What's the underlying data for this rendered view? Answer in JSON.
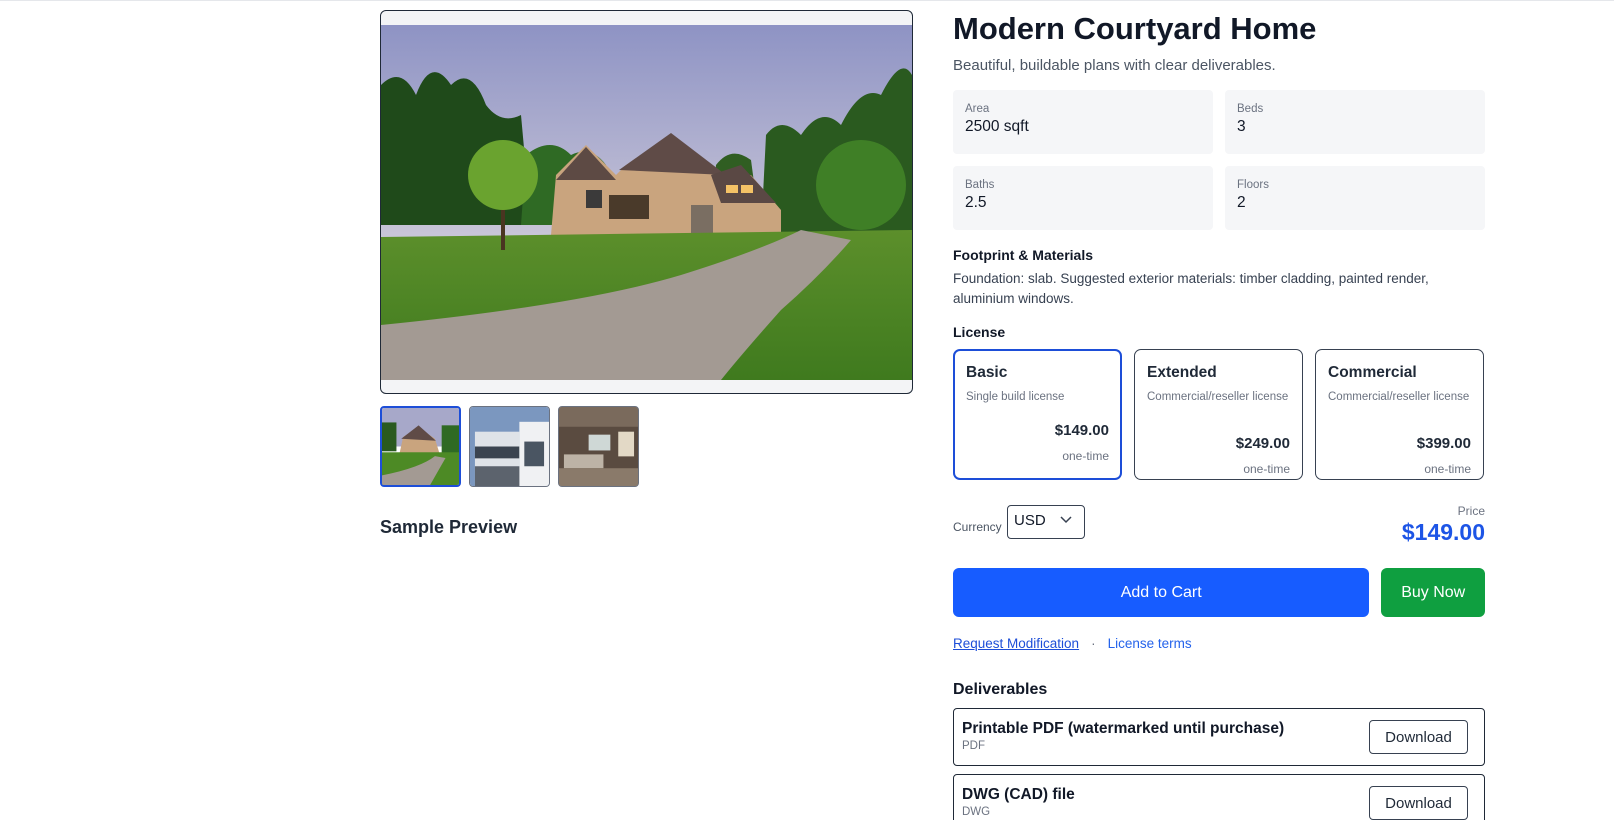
{
  "product": {
    "title": "Modern Courtyard Home",
    "tagline": "Beautiful, buildable plans with clear deliverables."
  },
  "specs": [
    {
      "label": "Area",
      "value": "2500 sqft"
    },
    {
      "label": "Beds",
      "value": "3"
    },
    {
      "label": "Baths",
      "value": "2.5"
    },
    {
      "label": "Floors",
      "value": "2"
    }
  ],
  "footprint": {
    "heading": "Footprint & Materials",
    "text": "Foundation: slab. Suggested exterior materials: timber cladding, painted render, aluminium windows."
  },
  "license": {
    "heading": "License",
    "options": [
      {
        "name": "Basic",
        "desc": "Single build license",
        "price": "$149.00",
        "unit": "one-time",
        "selected": true
      },
      {
        "name": "Extended",
        "desc": "Commercial/reseller license",
        "price": "$249.00",
        "unit": "one-time",
        "selected": false
      },
      {
        "name": "Commercial",
        "desc": "Commercial/reseller license",
        "price": "$399.00",
        "unit": "one-time",
        "selected": false
      }
    ]
  },
  "currency": {
    "label": "Currency",
    "value": "USD"
  },
  "price": {
    "label": "Price",
    "value": "$149.00"
  },
  "actions": {
    "add_to_cart": "Add to Cart",
    "buy_now": "Buy Now"
  },
  "links": {
    "request": "Request Modification",
    "separator": "·",
    "terms": "License terms"
  },
  "gallery": {
    "sample_preview": "Sample Preview",
    "thumbnails": [
      "house-exterior",
      "modern-facade",
      "living-room"
    ]
  },
  "deliverables": {
    "heading": "Deliverables",
    "items": [
      {
        "title": "Printable PDF (watermarked until purchase)",
        "type": "PDF",
        "button": "Download"
      },
      {
        "title": "DWG (CAD) file",
        "type": "DWG",
        "button": "Download"
      }
    ]
  },
  "colors": {
    "accent": "#175cff",
    "buy": "#0f9f40",
    "price": "#1d55e6",
    "selected_border": "#1d4ed8"
  }
}
